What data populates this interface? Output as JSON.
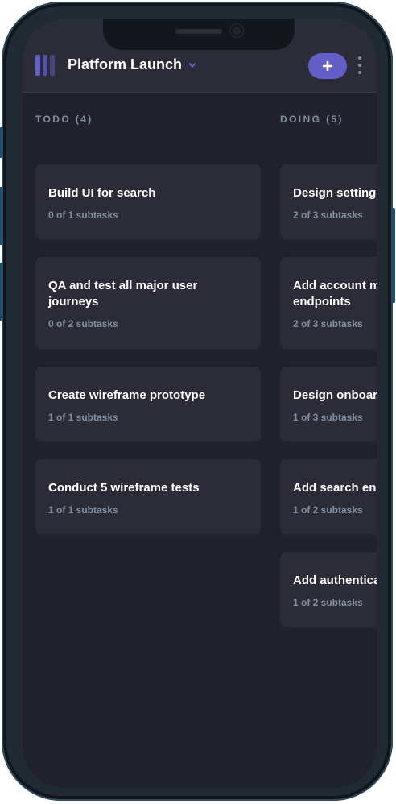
{
  "header": {
    "board_title": "Platform Launch"
  },
  "colors": {
    "accent": "#635fc7",
    "background": "#20212c",
    "card": "#2b2c37",
    "muted_text": "#828fa3"
  },
  "columns": [
    {
      "heading": "TODO (4)",
      "cards": [
        {
          "title": "Build UI for search",
          "subtasks": "0 of 1 subtasks"
        },
        {
          "title": "QA and test all major user journeys",
          "subtasks": "0 of 2 subtasks"
        },
        {
          "title": "Create wireframe prototype",
          "subtasks": "1 of 1 subtasks"
        },
        {
          "title": "Conduct 5 wireframe tests",
          "subtasks": "1 of 1 subtasks"
        }
      ]
    },
    {
      "heading": "DOING (5)",
      "cards": [
        {
          "title": "Design settings",
          "subtasks": "2 of 3 subtasks"
        },
        {
          "title": "Add account management endpoints",
          "subtasks": "2 of 3 subtasks"
        },
        {
          "title": "Design onboarding flow",
          "subtasks": "1 of 3 subtasks"
        },
        {
          "title": "Add search endpoints",
          "subtasks": "1 of 2 subtasks"
        },
        {
          "title": "Add authentication endpoints",
          "subtasks": "1 of 2 subtasks"
        }
      ]
    }
  ]
}
